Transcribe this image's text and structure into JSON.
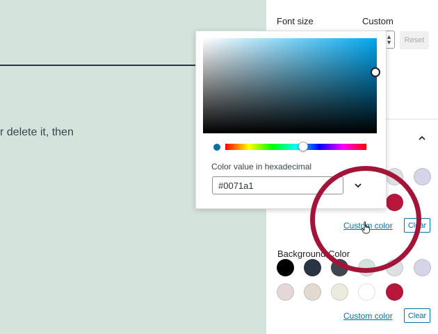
{
  "canvas": {
    "text": "r delete it, then"
  },
  "sidebar": {
    "font_size_label": "Font size",
    "custom_label": "Custom",
    "reset_label": "Reset",
    "text_color_swatches": [
      "#dde1e3",
      "#d6d4e8",
      "#b9163b"
    ],
    "custom_color_label": "Custom color",
    "clear_label": "Clear",
    "background_color_label": "Background Color",
    "background_swatches_row1": [
      "#000000",
      "#2a3444",
      "#3f4650",
      "#d4e4dc",
      "#dde1e3",
      "#d6d4e8"
    ],
    "background_swatches_row2": [
      "#e5d7d8",
      "#e2d9d0",
      "#ecebdf",
      "#ffffff",
      "#b9163b"
    ],
    "bg_custom_color_label": "Custom color",
    "bg_clear_label": "Clear"
  },
  "color_picker": {
    "hex_label": "Color value in hexadecimal",
    "hex_value": "#0071a1",
    "selected_color": "#0071a1",
    "format_toggle_icon": "chevron-down-icon"
  },
  "colors": {
    "highlight_ring": "#a31538",
    "link": "#0071a1",
    "canvas_bg": "#d4e4dc"
  }
}
